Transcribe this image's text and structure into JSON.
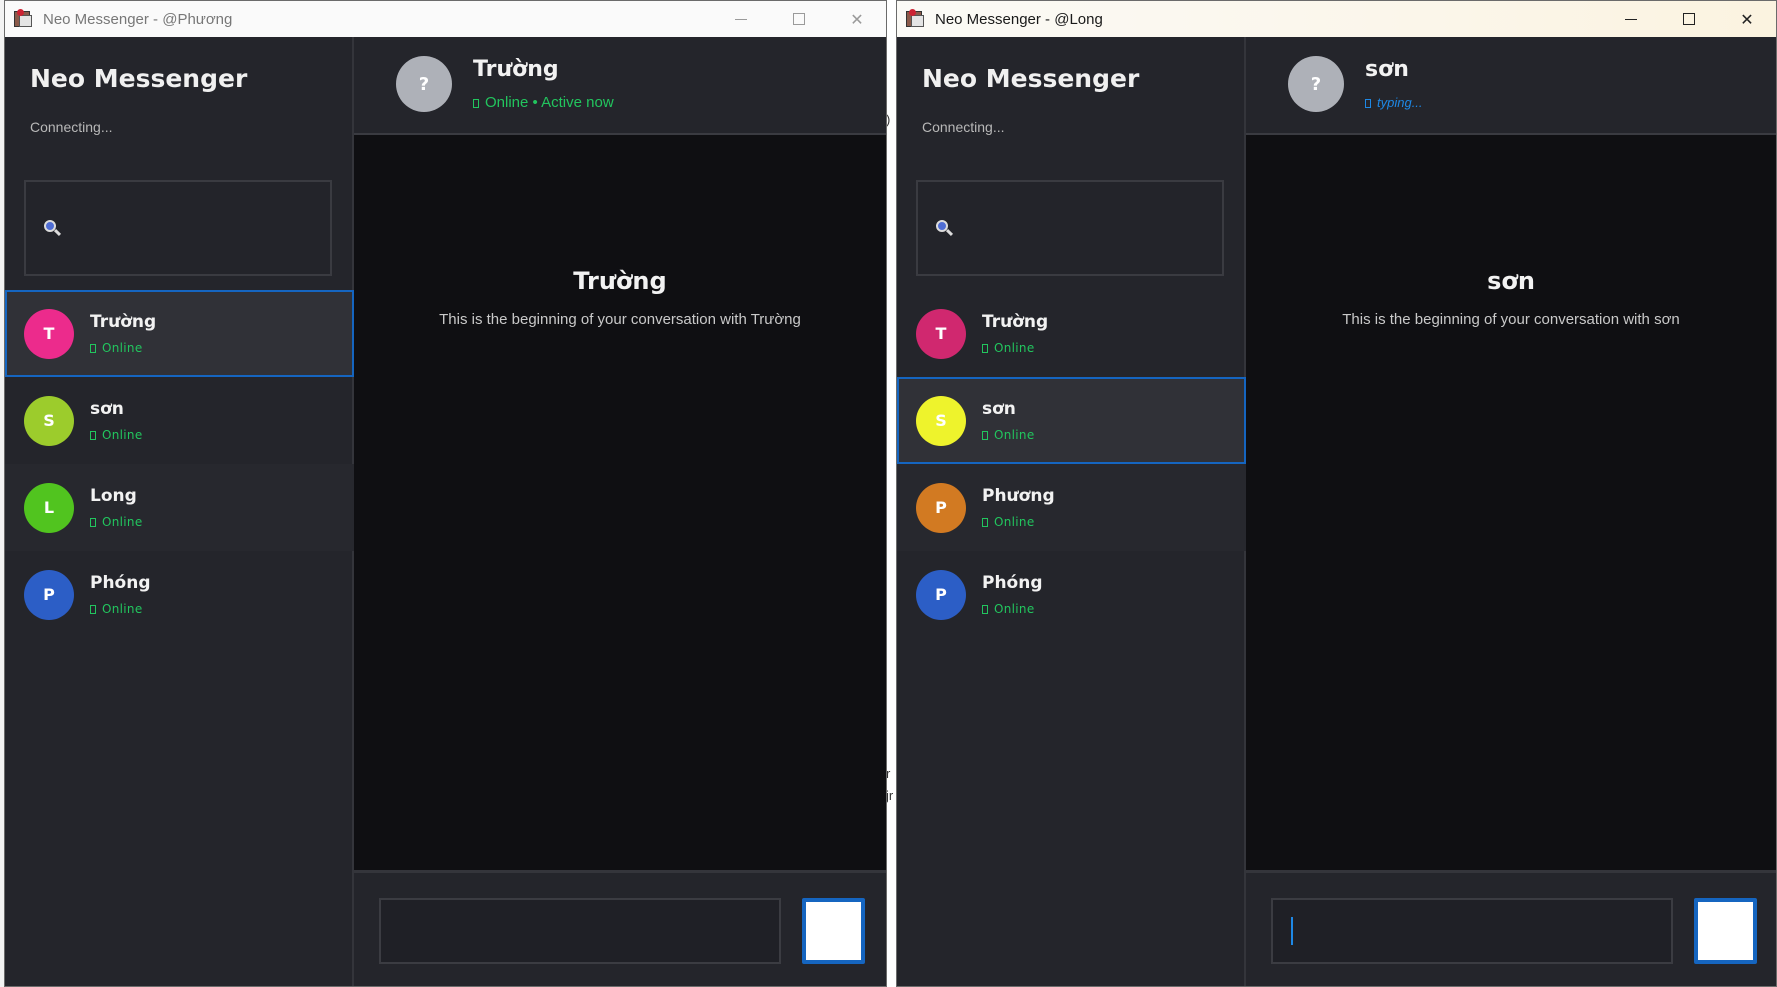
{
  "windows": [
    {
      "title": "Neo Messenger - @Phương",
      "app_name": "Neo Messenger",
      "connection_status": "Connecting...",
      "search": {
        "value": "",
        "placeholder": ""
      },
      "contacts": [
        {
          "initial": "T",
          "name": "Trường",
          "status": "Online",
          "color": "#ec2b8c",
          "selected": true
        },
        {
          "initial": "S",
          "name": "sơn",
          "status": "Online",
          "color": "#9ccc2c",
          "selected": false
        },
        {
          "initial": "L",
          "name": "Long",
          "status": "Online",
          "color": "#51c41f",
          "selected": false
        },
        {
          "initial": "P",
          "name": "Phóng",
          "status": "Online",
          "color": "#2c5ec6",
          "selected": false
        }
      ],
      "chat": {
        "avatar": "?",
        "name": "Trường",
        "status": "Online • Active now",
        "intro_title": "Trường",
        "intro_text": "This is the beginning of your conversation with Trường",
        "input_value": ""
      }
    },
    {
      "title": "Neo Messenger - @Long",
      "app_name": "Neo Messenger",
      "connection_status": "Connecting...",
      "search": {
        "value": "",
        "placeholder": ""
      },
      "contacts": [
        {
          "initial": "T",
          "name": "Trường",
          "status": "Online",
          "color": "#d0286f",
          "selected": false
        },
        {
          "initial": "S",
          "name": "sơn",
          "status": "Online",
          "color": "#eef32c",
          "selected": true
        },
        {
          "initial": "P",
          "name": "Phương",
          "status": "Online",
          "color": "#d27a22",
          "selected": false
        },
        {
          "initial": "P",
          "name": "Phóng",
          "status": "Online",
          "color": "#2c5ec6",
          "selected": false
        }
      ],
      "chat": {
        "avatar": "?",
        "name": "sơn",
        "status": "typing...",
        "intro_title": "sơn",
        "intro_text": "This is the beginning of your conversation with sơn",
        "input_value": ""
      }
    }
  ],
  "colors": {
    "accent": "#1565c0",
    "online": "#22c55e",
    "typing": "#1e88e5",
    "background": "#0f0f12",
    "panel": "#24252b"
  },
  "icons": {
    "search": "search-icon",
    "status": "status-glyph-icon",
    "minimize": "minimize-icon",
    "maximize": "maximize-icon",
    "close": "close-icon"
  },
  "background_fragments": [
    ")",
    "r",
    "jr"
  ]
}
